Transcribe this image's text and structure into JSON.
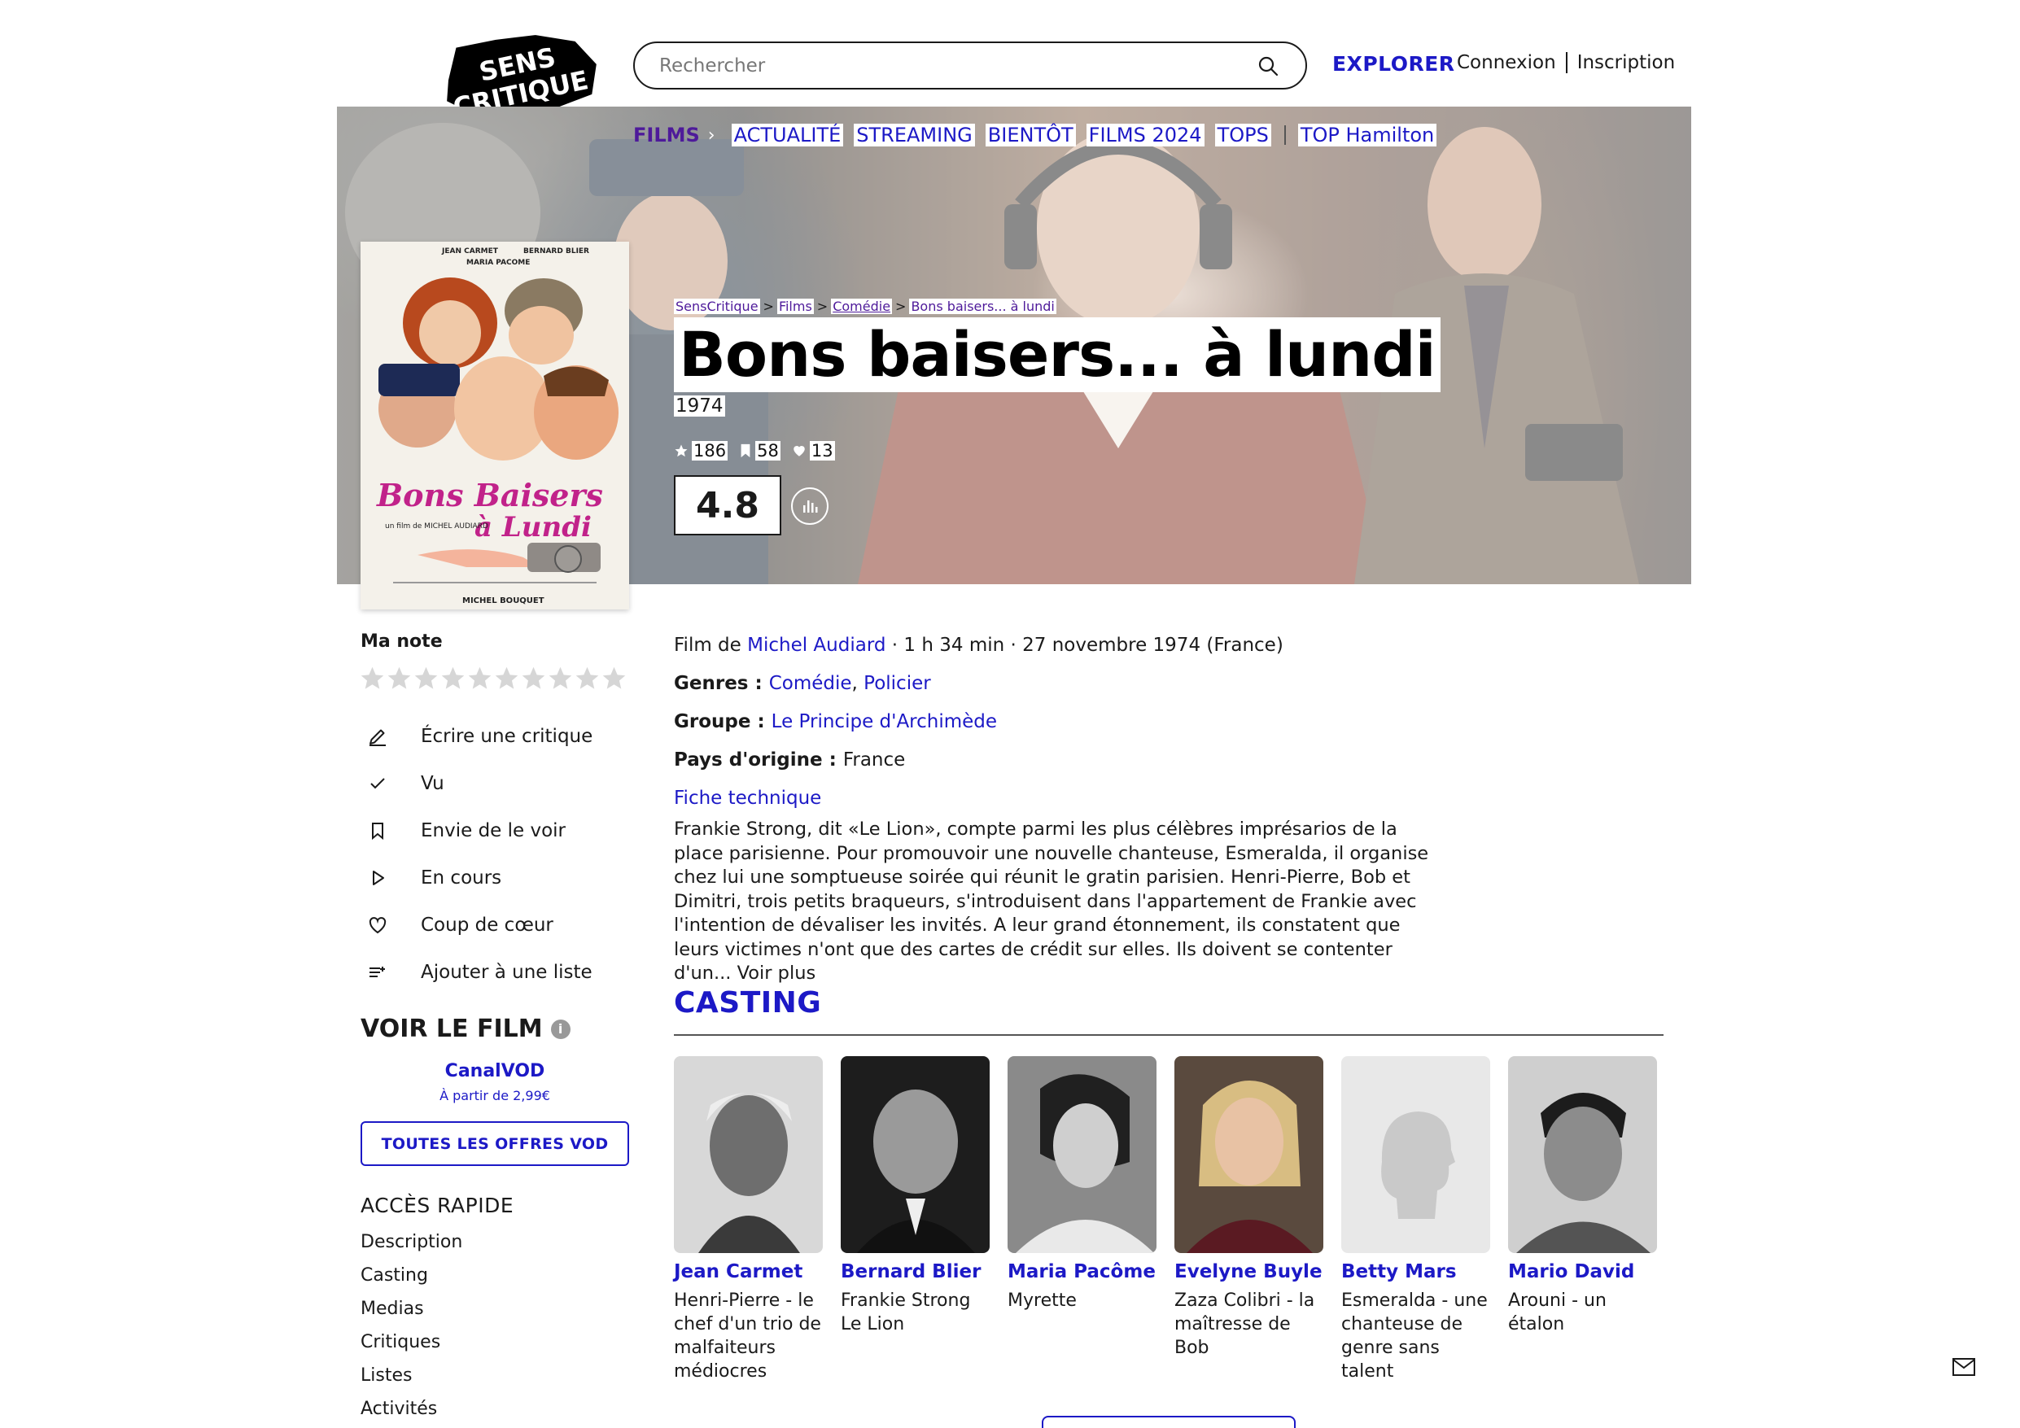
{
  "brand": {
    "logo_text": "SENS CRITIQUE"
  },
  "search": {
    "placeholder": "Rechercher"
  },
  "header": {
    "explore": "EXPLORER",
    "login": "Connexion",
    "signup": "Inscription"
  },
  "subnav": {
    "section": "FILMS",
    "items": [
      "ACTUALITÉ",
      "STREAMING",
      "BIENTÔT",
      "FILMS 2024",
      "TOPS"
    ],
    "extra": "TOP Hamilton"
  },
  "breadcrumb": [
    "SensCritique",
    "Films",
    "Comédie",
    "Bons baisers... à lundi"
  ],
  "film": {
    "title": "Bons baisers... à lundi",
    "year": "1974",
    "stats": {
      "ratings": "186",
      "wishlist": "58",
      "favorites": "13"
    },
    "score": "4.8",
    "director_prefix": "Film de ",
    "director": "Michel Audiard",
    "meta_suffix": " · 1 h 34 min · 27 novembre 1974 (France)",
    "genres_label": "Genres : ",
    "genres": [
      "Comédie",
      "Policier"
    ],
    "group_label": "Groupe : ",
    "group": "Le Principe d'Archimède",
    "country_label": "Pays d'origine : ",
    "country": "France",
    "tech_sheet": "Fiche technique",
    "synopsis": "Frankie Strong, dit «Le Lion», compte parmi les plus célèbres imprésarios de la place parisienne. Pour promouvoir une nouvelle chanteuse, Esmeralda, il organise chez lui une somptueuse soirée qui réunit le gratin parisien. Henri-Pierre, Bob et Dimitri, trois petits braqueurs, s'introduisent dans l'appartement de Frankie avec l'intention de dévaliser les invités. A leur grand étonnement, ils constatent que leurs victimes n'ont que des cartes de crédit sur elles. Ils doivent se contenter d'un...",
    "more": " Voir plus"
  },
  "poster": {
    "top_names": [
      "JEAN CARMET",
      "MARIA PACOME",
      "BERNARD BLIER"
    ],
    "title_line1": "Bons Baisers",
    "title_line2": "à Lundi",
    "credit": "un film de MICHEL AUDIARD",
    "bottom_name": "MICHEL BOUQUET"
  },
  "sidebar": {
    "my_rating": "Ma note",
    "star_count": 10,
    "actions": [
      {
        "icon": "pencil-icon",
        "label": "Écrire une critique"
      },
      {
        "icon": "check-icon",
        "label": "Vu"
      },
      {
        "icon": "bookmark-icon",
        "label": "Envie de le voir"
      },
      {
        "icon": "play-icon",
        "label": "En cours"
      },
      {
        "icon": "heart-icon",
        "label": "Coup de cœur"
      },
      {
        "icon": "add-list-icon",
        "label": "Ajouter à une liste"
      }
    ],
    "watch_title": "VOIR LE FILM",
    "vod_name": "CanalVOD",
    "vod_price": "À partir de 2,99€",
    "vod_button": "TOUTES LES OFFRES VOD",
    "quick_access_title": "ACCÈS RAPIDE",
    "quick_access": [
      "Description",
      "Casting",
      "Medias",
      "Critiques",
      "Listes",
      "Activités"
    ]
  },
  "casting": {
    "title": "CASTING",
    "members": [
      {
        "name": "Jean Carmet",
        "role": "Henri-Pierre - le chef d'un trio de malfaiteurs médiocres"
      },
      {
        "name": "Bernard Blier",
        "role": "Frankie Strong Le Lion"
      },
      {
        "name": "Maria Pacôme",
        "role": "Myrette"
      },
      {
        "name": "Evelyne Buyle",
        "role": "Zaza Colibri - la maîtresse de Bob"
      },
      {
        "name": "Betty Mars",
        "role": "Esmeralda - une chanteuse de genre sans talent"
      },
      {
        "name": "Mario David",
        "role": "Arouni - un étalon"
      }
    ]
  },
  "colors": {
    "accent": "#1c19c6",
    "purple": "#4e1a9a",
    "text": "#1a1a1a"
  }
}
